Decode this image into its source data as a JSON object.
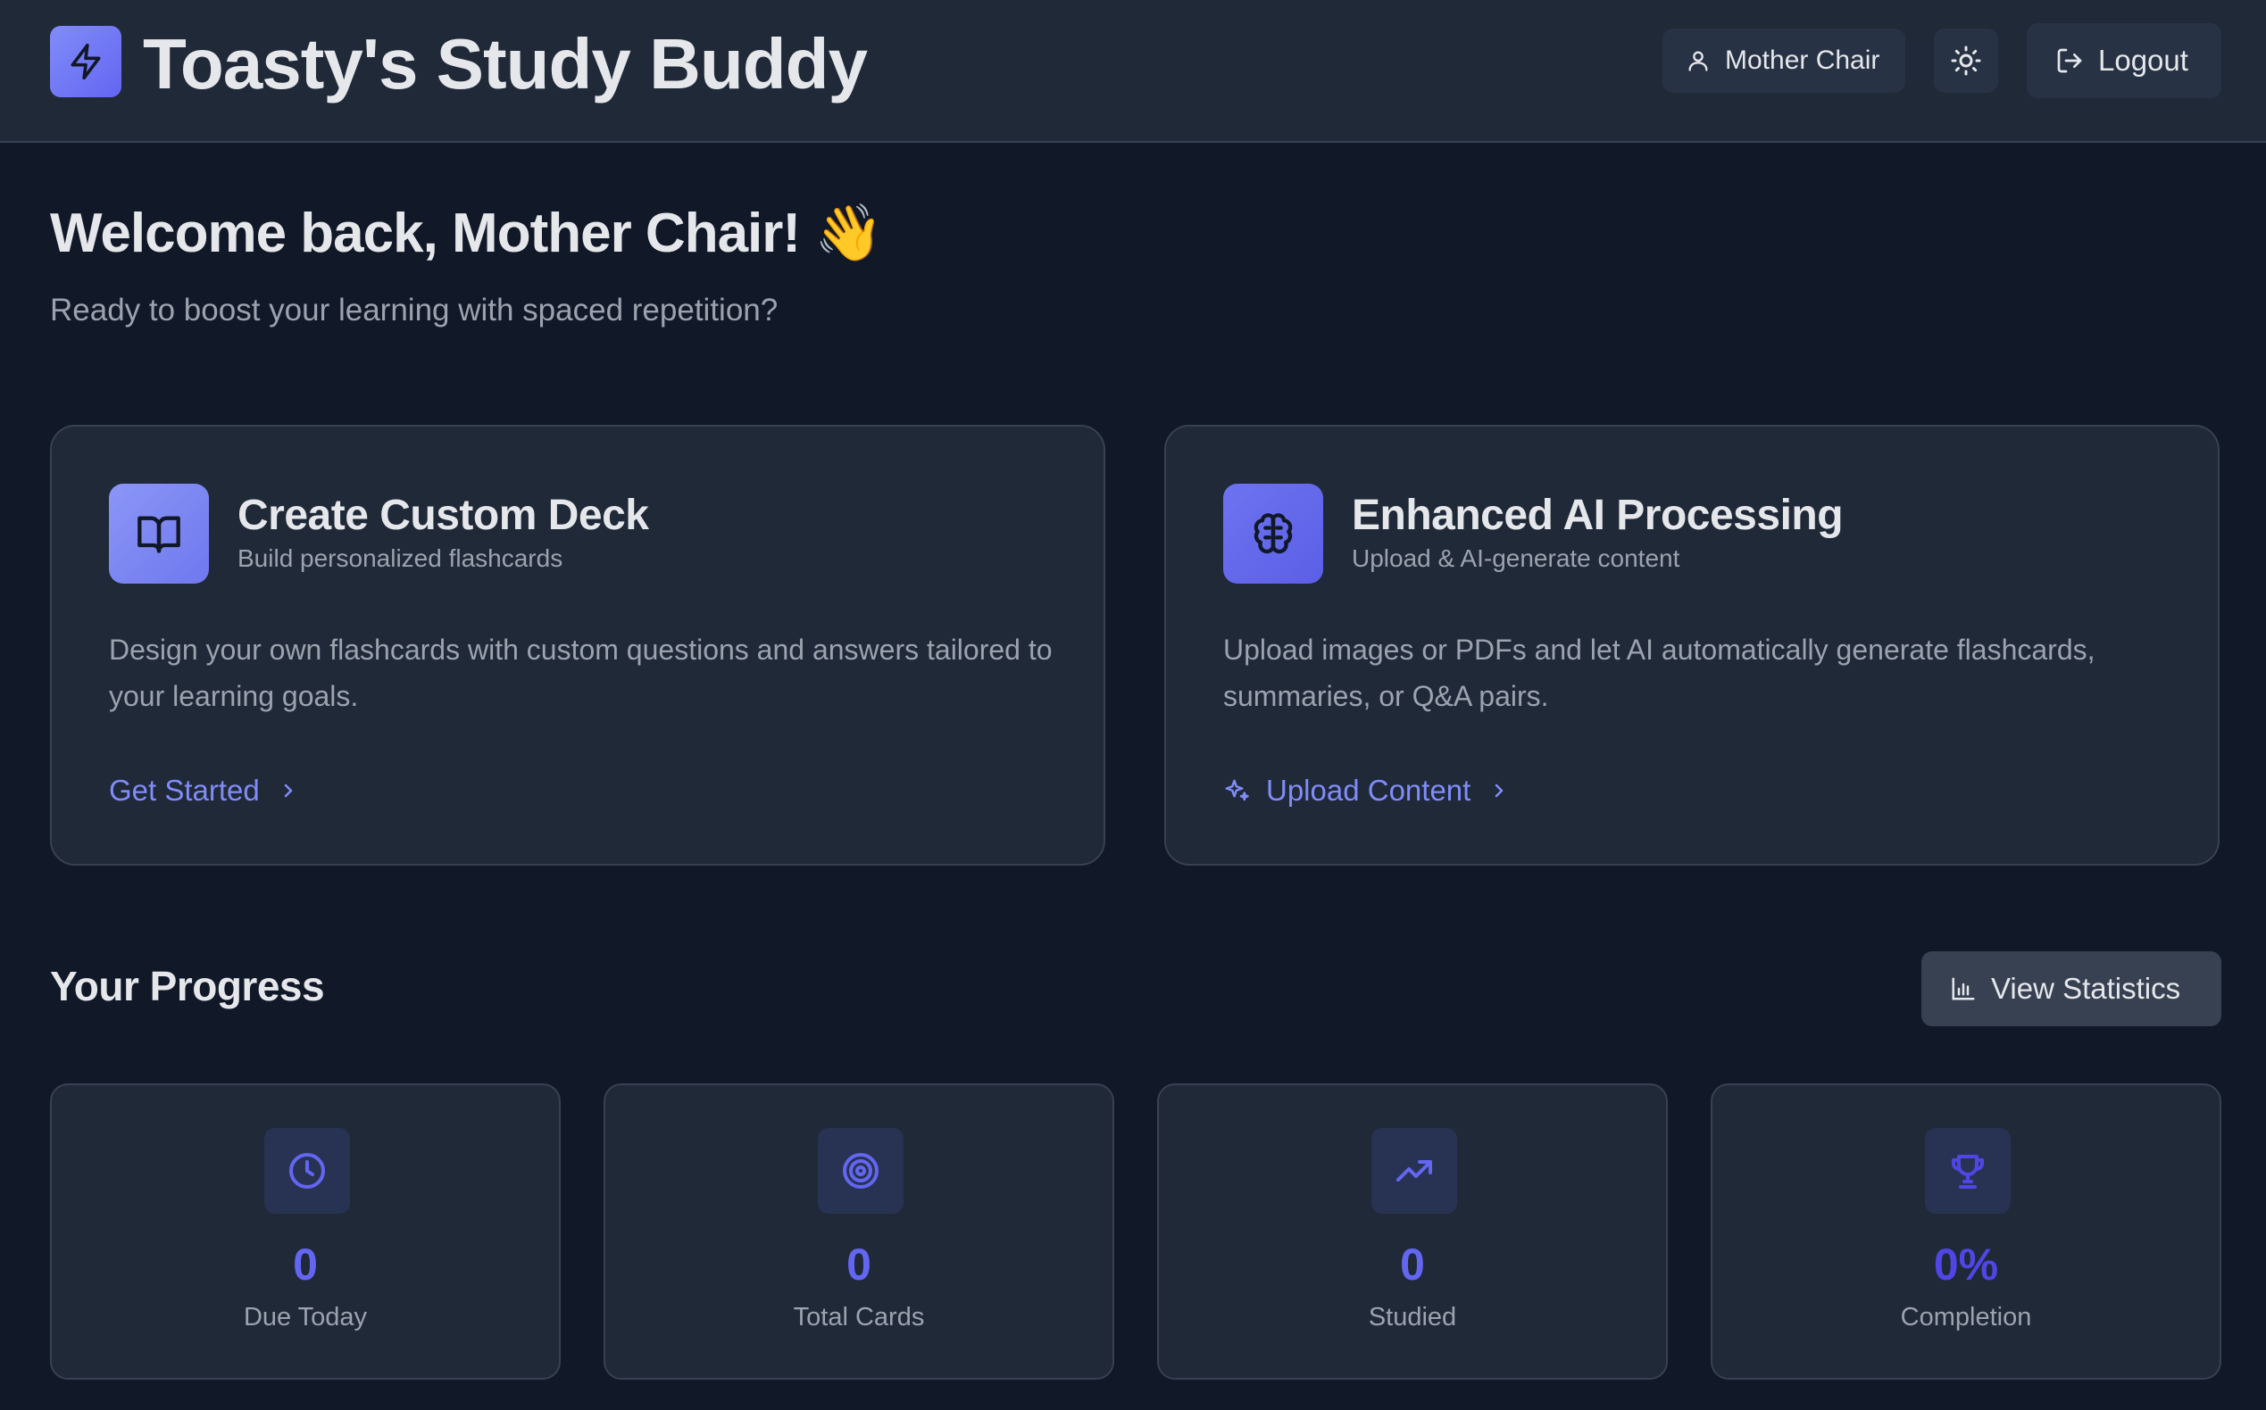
{
  "header": {
    "app_title": "Toasty's Study Buddy",
    "logo_icon": "lightning-bolt-icon",
    "user_name": "Mother Chair",
    "theme_icon": "sun-icon",
    "logout_label": "Logout"
  },
  "welcome": {
    "title": "Welcome back, Mother Chair! 👋",
    "subtitle": "Ready to boost your learning with spaced repetition?"
  },
  "cards": [
    {
      "icon": "book-open-icon",
      "title": "Create Custom Deck",
      "subtitle": "Build personalized flashcards",
      "description": "Design your own flashcards with custom questions and answers tailored to your learning goals.",
      "link_label": "Get Started"
    },
    {
      "icon": "brain-icon",
      "title": "Enhanced AI Processing",
      "subtitle": "Upload & AI-generate content",
      "description": "Upload images or PDFs and let AI automatically generate flashcards, summaries, or Q&A pairs.",
      "link_label": "Upload Content",
      "link_icon": "sparkles-icon"
    }
  ],
  "progress": {
    "title": "Your Progress",
    "view_stats_label": "View Statistics",
    "stats": [
      {
        "icon": "clock-icon",
        "value": "0",
        "label": "Due Today"
      },
      {
        "icon": "target-icon",
        "value": "0",
        "label": "Total Cards"
      },
      {
        "icon": "trending-up-icon",
        "value": "0",
        "label": "Studied"
      },
      {
        "icon": "trophy-icon",
        "value": "0%",
        "label": "Completion"
      }
    ]
  },
  "colors": {
    "background": "#111827",
    "surface": "#1f2937",
    "accent": "#6366f1",
    "accent_light": "#818cf8",
    "text": "#e5e7eb",
    "muted": "#9ca3af"
  }
}
